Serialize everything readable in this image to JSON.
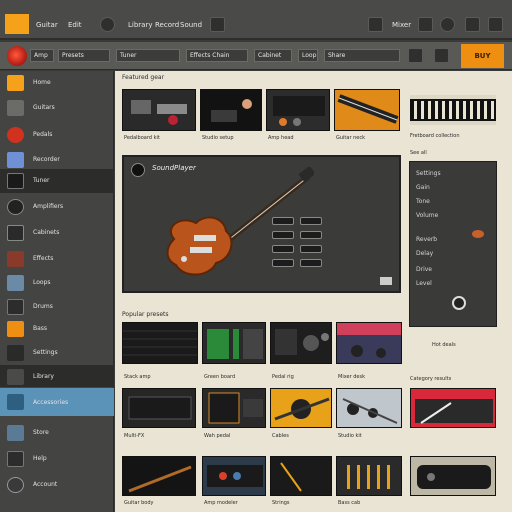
{
  "app": {
    "title": ""
  },
  "menubar": {
    "items": [
      "Guitar",
      "Edit",
      "Library",
      "Record",
      "Sound",
      "Mixer",
      "Export",
      "Help"
    ]
  },
  "toolbar": {
    "chips": [
      "Amp",
      "Presets",
      "Tuner",
      "Effects Chain",
      "Cabinet",
      "Loop",
      "Share"
    ],
    "buy_label": "BUY"
  },
  "sidebar": {
    "items": [
      {
        "label": "Home",
        "icon": "home-icon"
      },
      {
        "label": "Guitars",
        "icon": "guitar-icon"
      },
      {
        "label": "Pedals",
        "icon": "pedal-icon"
      },
      {
        "label": "Recorder",
        "icon": "record-icon"
      },
      {
        "label": "Tuner",
        "icon": "tuner-icon"
      },
      {
        "label": "Amplifiers",
        "icon": "amp-icon"
      },
      {
        "label": "Cabinets",
        "icon": "speaker-icon"
      },
      {
        "label": "Effects",
        "icon": "effects-icon"
      },
      {
        "label": "Loops",
        "icon": "loop-icon"
      },
      {
        "label": "Drums",
        "icon": "drum-icon"
      },
      {
        "label": "Bass",
        "icon": "bass-icon"
      },
      {
        "label": "Settings",
        "icon": "gear-icon"
      },
      {
        "label": "Library",
        "icon": "library-icon"
      },
      {
        "label": "Accessories",
        "icon": "accessory-icon"
      },
      {
        "label": "Store",
        "icon": "store-icon"
      },
      {
        "label": "Help",
        "icon": "help-icon"
      },
      {
        "label": "Account",
        "icon": "user-icon"
      }
    ]
  },
  "content": {
    "featured_label": "Featured gear",
    "thumbs_row1_captions": [
      "Pedalboard kit",
      "Studio setup",
      "Amp head",
      "Guitar neck"
    ],
    "banner_caption": "Fretboard collection",
    "banner_sub": "See all",
    "hero_title": "SoundPlayer",
    "right_panel_lines": [
      "Settings",
      "Gain",
      "Tone",
      "Volume",
      "Reverb",
      "Delay",
      "Drive",
      "Level"
    ],
    "row2_label": "Popular presets",
    "row2_captions": [
      "Stack amp",
      "Green board",
      "Pedal rig",
      "Mixer desk"
    ],
    "row2_right_label": "Hot deals",
    "row2_right_caption": "Category results",
    "row3_captions": [
      "Multi-FX",
      "Wah pedal",
      "Cables",
      "Studio kit"
    ],
    "row4_captions": [
      "Guitar body",
      "Amp modeler",
      "Strings",
      "Bass cab"
    ]
  },
  "colors": {
    "accent_orange": "#ef8f12",
    "active_blue": "#5b93b8",
    "content_bg": "#e9e4d3"
  }
}
